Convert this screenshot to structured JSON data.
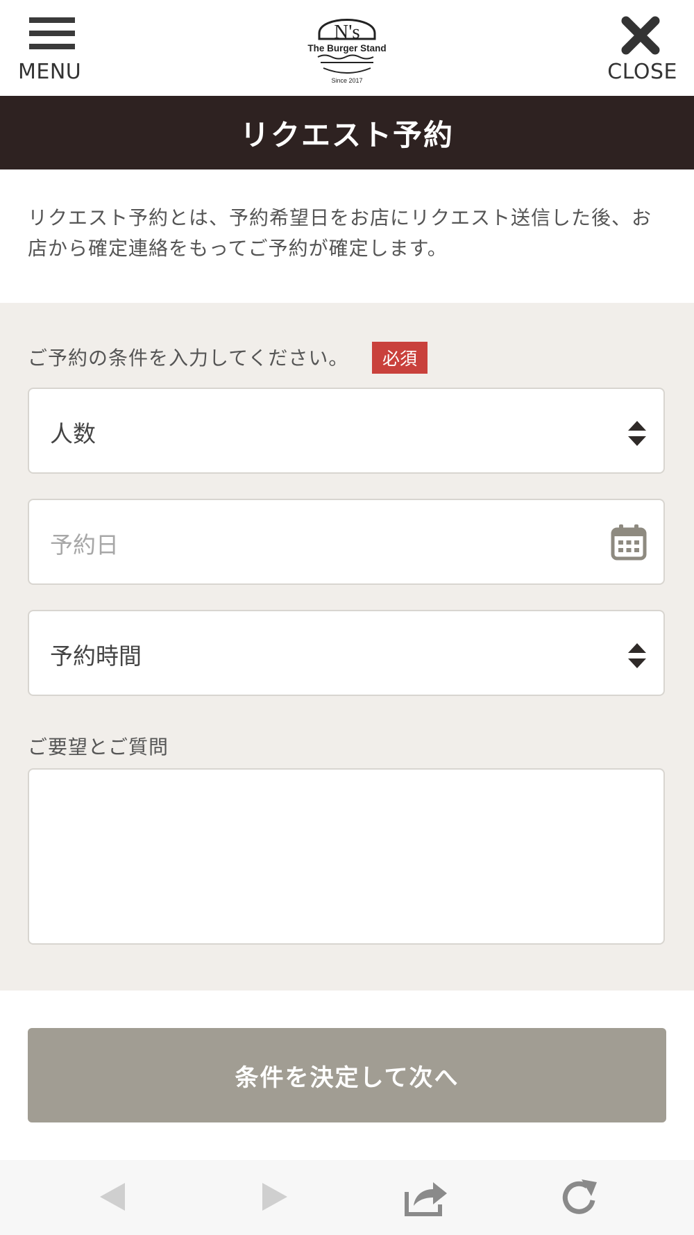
{
  "header": {
    "menu_label": "MENU",
    "close_label": "CLOSE",
    "logo": {
      "main": "N's",
      "sub": "The Burger Stand",
      "since": "Since 2017"
    }
  },
  "page_title": "リクエスト予約",
  "intro_text": "リクエスト予約とは、予約希望日をお店にリクエスト送信した後、お店から確定連絡をもってご予約が確定します。",
  "form": {
    "conditions_label": "ご予約の条件を入力してください。",
    "required_badge": "必須",
    "party_size": {
      "value": "人数"
    },
    "date": {
      "placeholder": "予約日"
    },
    "time": {
      "value": "予約時間"
    },
    "requests_label": "ご要望とご質問",
    "requests_value": ""
  },
  "submit_label": "条件を決定して次へ",
  "colors": {
    "title_bar": "#2e2221",
    "form_bg": "#f1eeea",
    "badge": "#c9413c",
    "submit": "#a19d93"
  },
  "toolbar": {
    "icons": [
      "back-arrow-icon",
      "forward-arrow-icon",
      "share-icon",
      "reload-icon"
    ]
  }
}
